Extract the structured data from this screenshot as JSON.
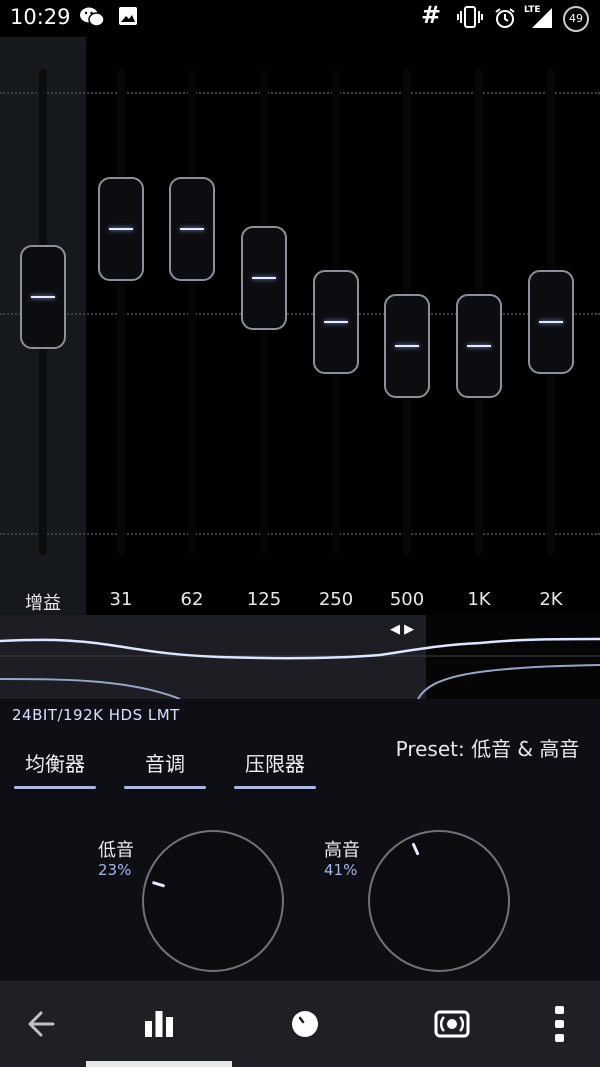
{
  "status_bar": {
    "time": "10:29",
    "icons_left": [
      "wechat-icon",
      "image-icon"
    ],
    "icons_right": [
      "hash-icon",
      "vibrate-icon",
      "alarm-icon",
      "lte-signal-icon"
    ],
    "network": "LTE",
    "battery": "49"
  },
  "equalizer": {
    "bands": [
      {
        "label": "增益",
        "level": 0.53
      },
      {
        "label": "31",
        "level": 0.67
      },
      {
        "label": "62",
        "level": 0.67
      },
      {
        "label": "125",
        "level": 0.57
      },
      {
        "label": "250",
        "level": 0.48
      },
      {
        "label": "500",
        "level": 0.43
      },
      {
        "label": "1K",
        "level": 0.43
      },
      {
        "label": "2K",
        "level": 0.48
      }
    ]
  },
  "curve": {
    "scroll_arrows": "◀ ▶"
  },
  "info_bar": {
    "spec_text": "24BIT/192K HDS LMT"
  },
  "tabs": [
    {
      "label": "均衡器"
    },
    {
      "label": "音调"
    },
    {
      "label": "压限器"
    }
  ],
  "preset": {
    "text": "Preset: 低音 & 高音"
  },
  "dials": [
    {
      "label": "低音",
      "percent": "23%",
      "value": 0.23
    },
    {
      "label": "高音",
      "percent": "41%",
      "value": 0.41
    }
  ],
  "nav": {
    "items": [
      {
        "name": "back",
        "icon": "back-arrow-icon"
      },
      {
        "name": "equalizer",
        "icon": "equalizer-bars-icon"
      },
      {
        "name": "tone",
        "icon": "tone-knob-icon"
      },
      {
        "name": "visualizer",
        "icon": "visualizer-icon"
      },
      {
        "name": "menu",
        "icon": "more-vertical-icon"
      }
    ]
  },
  "colors": {
    "accent": "#aeb7e6",
    "percent": "#a7b6e8",
    "nav_bg": "#1e2026"
  }
}
